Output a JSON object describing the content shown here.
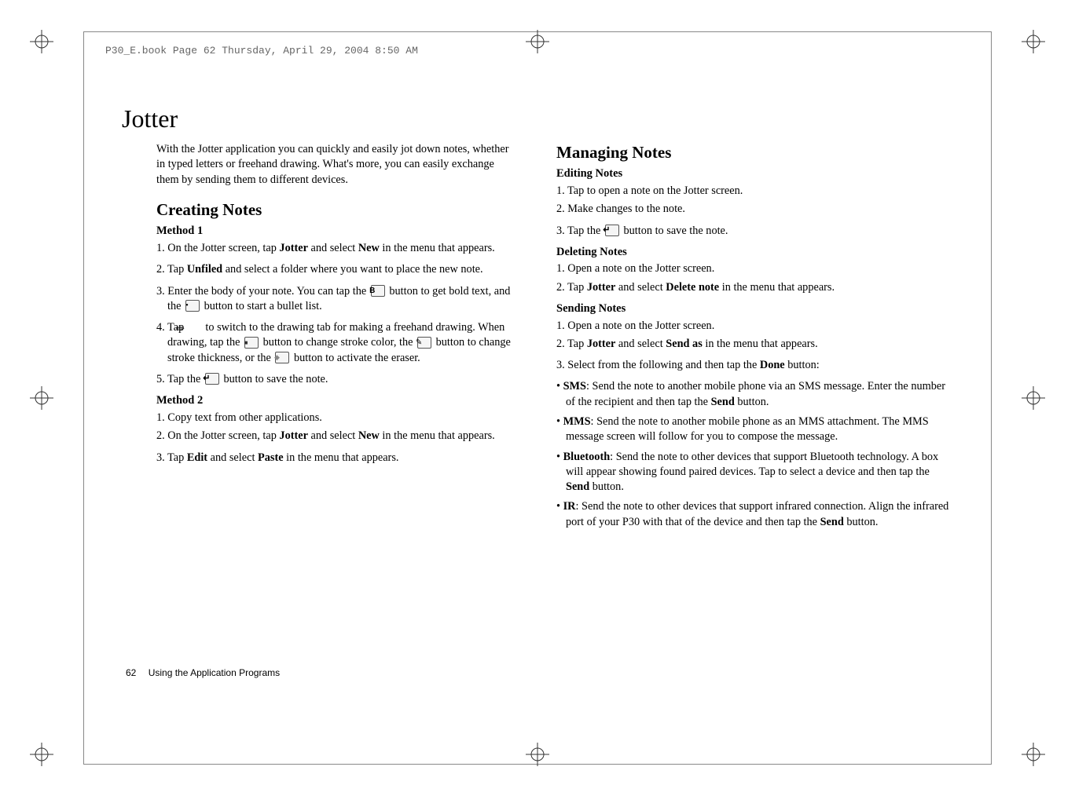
{
  "header": "P30_E.book  Page 62  Thursday, April 29, 2004  8:50 AM",
  "title": "Jotter",
  "intro": "With the Jotter application you can quickly and easily jot down notes, whether in typed letters or freehand drawing. What's more, you can easily exchange them by sending them to different devices.",
  "sections": {
    "creating": {
      "heading": "Creating Notes",
      "method1": {
        "label": "Method 1",
        "s1a": "1. On the Jotter screen, tap ",
        "s1b": "Jotter",
        "s1c": " and select ",
        "s1d": "New",
        "s1e": " in the menu that appears.",
        "s2a": "2. Tap ",
        "s2b": "Unfiled",
        "s2c": " and select a folder where you want to place the new note.",
        "s3a": "3. Enter the body of your note. You can tap the ",
        "s3b": " button to get bold text, and the ",
        "s3c": " button to start a bullet list.",
        "s4a": "4. Tap ",
        "s4b": " to switch to the drawing tab for making a freehand drawing. When drawing, tap the ",
        "s4c": " button to change stroke color, the ",
        "s4d": " button to change stroke thickness, or the ",
        "s4e": " button to activate the eraser.",
        "s5a": "5. Tap the ",
        "s5b": " button to save the note."
      },
      "method2": {
        "label": "Method 2",
        "s1": "1. Copy text from other applications.",
        "s2a": "2. On the Jotter screen, tap ",
        "s2b": "Jotter",
        "s2c": " and select ",
        "s2d": "New",
        "s2e": " in the menu that appears.",
        "s3a": "3. Tap ",
        "s3b": "Edit",
        "s3c": " and select ",
        "s3d": "Paste",
        "s3e": " in the menu that appears."
      }
    },
    "managing": {
      "heading": "Managing Notes",
      "editing": {
        "label": "Editing Notes",
        "s1": "1. Tap to open a note on the Jotter screen.",
        "s2": "2. Make changes to the note.",
        "s3a": "3. Tap the ",
        "s3b": " button to save the note."
      },
      "deleting": {
        "label": "Deleting Notes",
        "s1": "1. Open a note on the Jotter screen.",
        "s2a": "2. Tap ",
        "s2b": "Jotter",
        "s2c": " and select ",
        "s2d": "Delete note",
        "s2e": " in the menu that appears."
      },
      "sending": {
        "label": "Sending Notes",
        "s1": "1. Open a note on the Jotter screen.",
        "s2a": "2. Tap ",
        "s2b": "Jotter",
        "s2c": " and select ",
        "s2d": "Send as",
        "s2e": " in the menu that appears.",
        "s3a": "3. Select from the following and then tap the ",
        "s3b": "Done",
        "s3c": " button:",
        "b_sms_a": "SMS",
        "b_sms_b": ": Send the note to another mobile phone via an SMS message. Enter the number of the recipient and then tap the ",
        "b_sms_c": "Send",
        "b_sms_d": " button.",
        "b_mms_a": "MMS",
        "b_mms_b": ": Send the note to another mobile phone as an MMS attachment. The MMS message screen will follow for you to compose the message.",
        "b_bt_a": "Bluetooth",
        "b_bt_b": ": Send the note to other devices that support Bluetooth technology. A box will appear showing found paired devices. Tap to select a device and then tap the ",
        "b_bt_c": "Send",
        "b_bt_d": " button.",
        "b_ir_a": "IR",
        "b_ir_b": ": Send the note to other devices that support infrared connection. Align the infrared port of your P30 with that of the device and then tap the ",
        "b_ir_c": "Send",
        "b_ir_d": " button."
      }
    }
  },
  "footer": {
    "page": "62",
    "section": "Using the Application Programs"
  },
  "icons": {
    "bold": "B"
  }
}
